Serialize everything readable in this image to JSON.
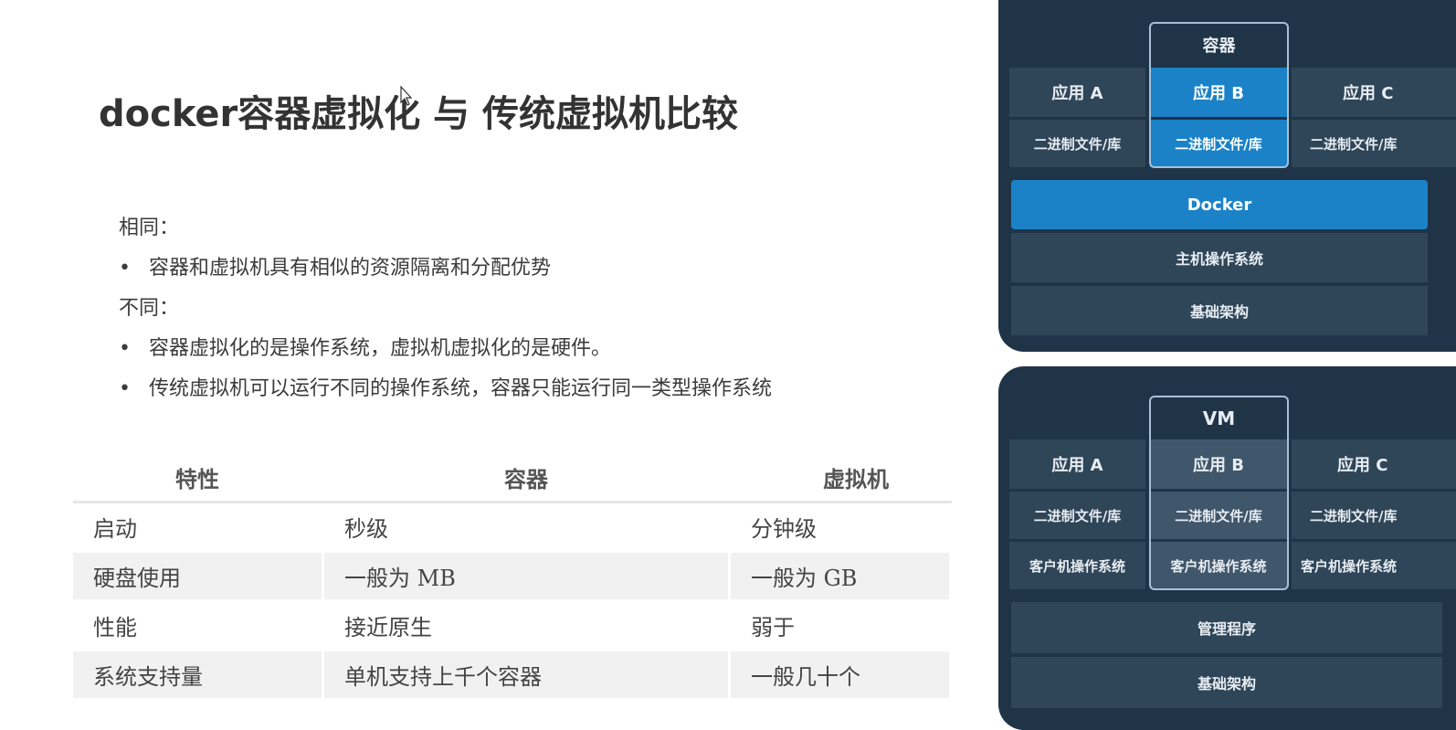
{
  "title": "docker容器虚拟化 与 传统虚拟机比较",
  "same": {
    "heading": "相同：",
    "items": [
      "容器和虚拟机具有相似的资源隔离和分配优势"
    ]
  },
  "diff": {
    "heading": "不同：",
    "items": [
      "容器虚拟化的是操作系统，虚拟机虚拟化的是硬件。",
      "传统虚拟机可以运行不同的操作系统，容器只能运行同一类型操作系统"
    ]
  },
  "table": {
    "headers": [
      "特性",
      "容器",
      "虚拟机"
    ],
    "rows": [
      [
        "启动",
        "秒级",
        "分钟级"
      ],
      [
        "硬盘使用",
        "一般为 MB",
        "一般为 GB"
      ],
      [
        "性能",
        "接近原生",
        "弱于"
      ],
      [
        "系统支持量",
        "单机支持上千个容器",
        "一般几十个"
      ]
    ]
  },
  "docker_diagram": {
    "frame_label": "容器",
    "apps": [
      "应用 A",
      "应用 B",
      "应用 C"
    ],
    "bins": [
      "二进制文件/库",
      "二进制文件/库",
      "二进制文件/库"
    ],
    "layers": [
      "Docker",
      "主机操作系统",
      "基础架构"
    ]
  },
  "vm_diagram": {
    "frame_label": "VM",
    "apps": [
      "应用 A",
      "应用 B",
      "应用 C"
    ],
    "bins": [
      "二进制文件/库",
      "二进制文件/库",
      "二进制文件/库"
    ],
    "guest_os": [
      "客户机操作系统",
      "客户机操作系统",
      "客户机操作系统"
    ],
    "layers": [
      "管理程序",
      "基础架构"
    ]
  },
  "colors": {
    "panel_bg": "#1f3447",
    "cell_bg": "#2f4558",
    "highlight_blue": "#1b82c8",
    "vm_highlight": "#40566a"
  }
}
